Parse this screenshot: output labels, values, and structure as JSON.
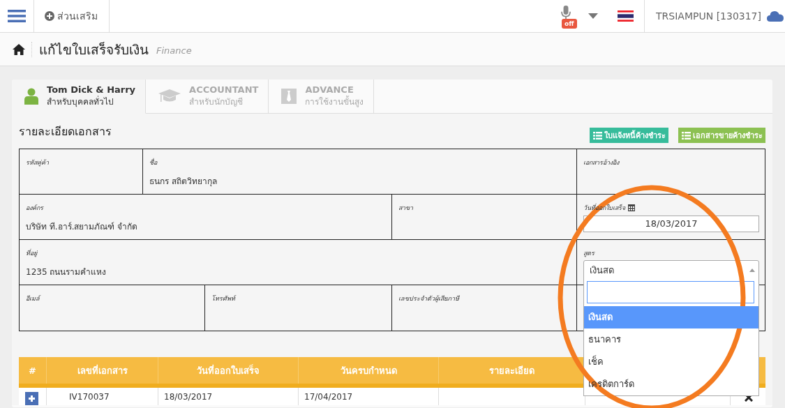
{
  "navbar": {
    "addons_label": "ส่วนเสริม",
    "mic_badge": "off",
    "user": "TRSIAMPUN [130317]"
  },
  "page_header": {
    "title": "แก้ไขใบเสร็จรับเงิน",
    "subtitle": "Finance"
  },
  "tabs": [
    {
      "kind": "person",
      "title": "Tom Dick & Harry",
      "subtitle": "สำหรับบุคคลทั่วไป",
      "selected": true
    },
    {
      "kind": "cap",
      "title": "ACCOUNTANT",
      "subtitle": "สำหรับนักบัญชี",
      "selected": false
    },
    {
      "kind": "tie",
      "title": "ADVANCE",
      "subtitle": "การใช้งานขั้นสูง",
      "selected": false
    }
  ],
  "section": {
    "title": "รายละเอียดเอกสาร",
    "buttons": [
      {
        "label": "ใบแจ้งหนี้ค้างชำระ",
        "color": "#37bc9b"
      },
      {
        "label": "เอกสารขายค้างชำระ",
        "color": "#8cc152"
      }
    ]
  },
  "form": {
    "fields": [
      {
        "label": "รหัสคู่ค้า"
      },
      {
        "label": "ชื่อ",
        "value": "ธนกร สถิตวิทยากุล"
      },
      {
        "label": "เอกสารอ้างอิง"
      },
      {
        "label": "องค์กร",
        "value": "บริษัท ที.อาร์.สยามภัณฑ์ จำกัด"
      },
      {
        "label": "สาขา"
      },
      {
        "label": "วันที่ออกใบเสร็จ",
        "kind": "date",
        "value": "18/03/2017"
      },
      {
        "label": "ที่อยู่",
        "value": "1235 ถนนรามคำแหง"
      },
      {
        "label": "สูตร",
        "kind": "select",
        "value": "เงินสด",
        "open": true
      },
      {
        "label": "อีเมล์"
      },
      {
        "label": "โทรศัพท์"
      },
      {
        "label": "เลขประจำตัวผู้เสียภาษี"
      }
    ]
  },
  "dropdown": {
    "options": [
      {
        "label": "เงินสด",
        "selected": true
      },
      {
        "label": "ธนาคาร",
        "selected": false
      },
      {
        "label": "เช็ค",
        "selected": false
      },
      {
        "label": "เครดิตการ์ด",
        "selected": false
      }
    ]
  },
  "table": {
    "columns": [
      "#",
      "เลขที่เอกสาร",
      "วันที่ออกใบเสร็จ",
      "วันครบกำหนด",
      "รายละเอียด"
    ],
    "rows": [
      {
        "number": "IV170037",
        "issue_date": "18/03/2017",
        "due_date": "17/04/2017"
      }
    ]
  }
}
